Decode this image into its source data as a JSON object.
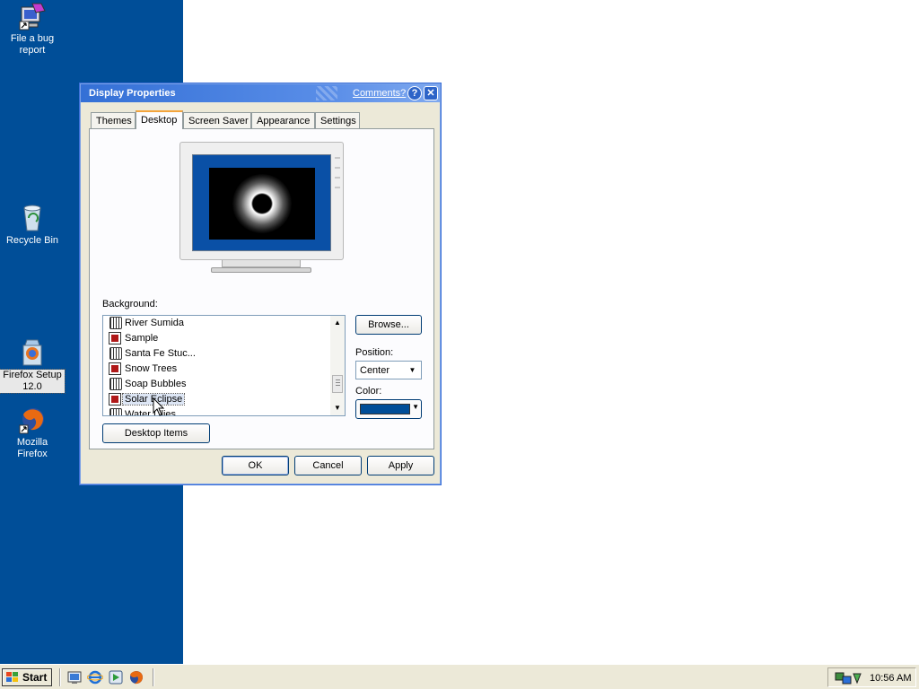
{
  "desktop": {
    "icons": [
      {
        "label": "File a bug report",
        "icon": "bug-report-icon"
      },
      {
        "label": "Recycle Bin",
        "icon": "recycle-bin-icon"
      },
      {
        "label": "Firefox Setup 12.0",
        "icon": "firefox-setup-icon"
      },
      {
        "label": "Mozilla Firefox",
        "icon": "firefox-icon"
      }
    ],
    "background_color": "#004e98"
  },
  "dialog": {
    "title": "Display Properties",
    "comments_link": "Comments?",
    "help_glyph": "?",
    "close_glyph": "✕",
    "tabs": [
      {
        "label": "Themes",
        "active": false
      },
      {
        "label": "Desktop",
        "active": true
      },
      {
        "label": "Screen Saver",
        "active": false
      },
      {
        "label": "Appearance",
        "active": false
      },
      {
        "label": "Settings",
        "active": false
      }
    ],
    "preview_image": "Solar Eclipse",
    "background_label": "Background:",
    "background_items": [
      {
        "label": "River Sumida",
        "icon": "picture-file-icon",
        "selected": false
      },
      {
        "label": "Sample",
        "icon": "image-file-icon",
        "selected": false
      },
      {
        "label": "Santa Fe Stuc...",
        "icon": "picture-file-icon",
        "selected": false
      },
      {
        "label": "Snow Trees",
        "icon": "image-file-icon",
        "selected": false
      },
      {
        "label": "Soap Bubbles",
        "icon": "picture-file-icon",
        "selected": false
      },
      {
        "label": "Solar Eclipse",
        "icon": "image-file-icon",
        "selected": true
      },
      {
        "label": "Water Lilies",
        "icon": "picture-file-icon",
        "selected": false
      }
    ],
    "browse_button": "Browse...",
    "position_label": "Position:",
    "position_value": "Center",
    "color_label": "Color:",
    "color_value": "#004e98",
    "desktop_items_button": "Desktop Items",
    "ok_button": "OK",
    "cancel_button": "Cancel",
    "apply_button": "Apply"
  },
  "taskbar": {
    "start_label": "Start",
    "quick_launch": [
      "show-desktop-icon",
      "internet-explorer-icon",
      "windows-media-icon",
      "firefox-icon"
    ],
    "clock": "10:56 AM"
  }
}
